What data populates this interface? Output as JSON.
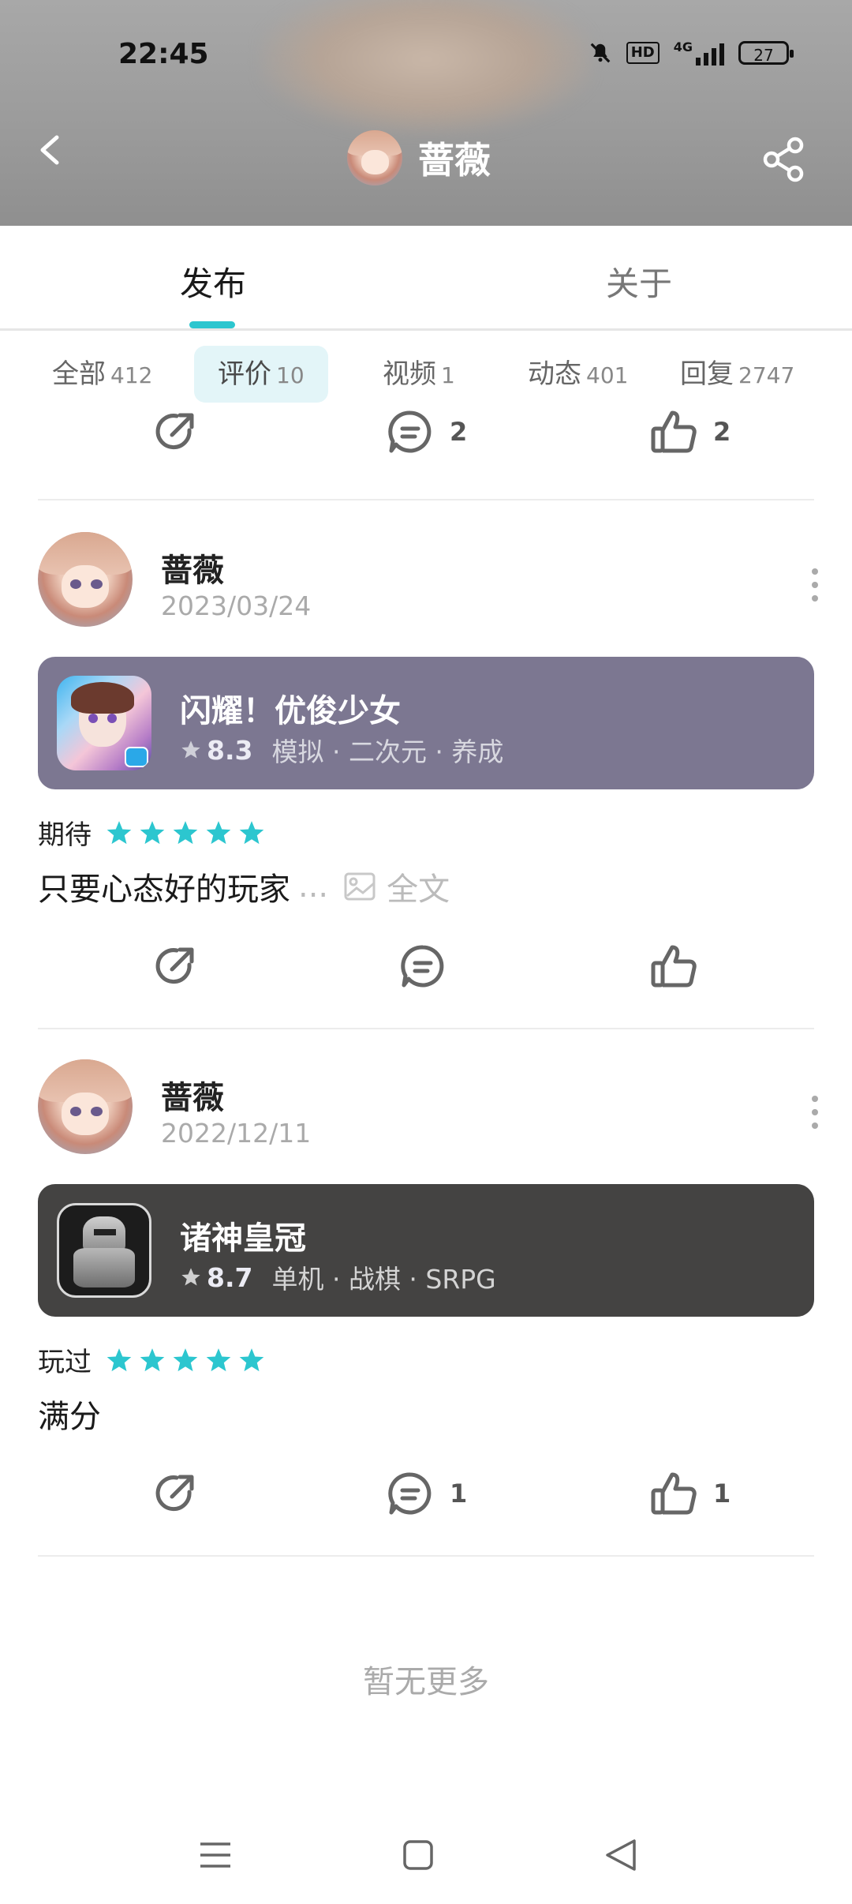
{
  "status_bar": {
    "time": "22:45",
    "hd": "HD",
    "network": "4G",
    "battery": "27"
  },
  "header": {
    "title": "蔷薇"
  },
  "tabs": [
    {
      "label": "发布"
    },
    {
      "label": "关于"
    }
  ],
  "filters": [
    {
      "label": "全部",
      "count": "412"
    },
    {
      "label": "评价",
      "count": "10"
    },
    {
      "label": "视频",
      "count": "1"
    },
    {
      "label": "动态",
      "count": "401"
    },
    {
      "label": "回复",
      "count": "2747"
    }
  ],
  "top_actions": {
    "comments": "2",
    "likes": "2"
  },
  "posts": [
    {
      "author": "蔷薇",
      "date": "2023/03/24",
      "game": {
        "title": "闪耀！优俊少女",
        "score": "8.3",
        "tags": "模拟 · 二次元 · 养成",
        "card_color": "#7c7791"
      },
      "rating_label": "期待",
      "stars": 5,
      "text": "只要心态好的玩家",
      "ellipsis": "...",
      "full_label": "全文",
      "comments": "",
      "likes": ""
    },
    {
      "author": "蔷薇",
      "date": "2022/12/11",
      "game": {
        "title": "诸神皇冠",
        "score": "8.7",
        "tags": "单机 · 战棋 · SRPG",
        "card_color": "#444342"
      },
      "rating_label": "玩过",
      "stars": 5,
      "text": "满分",
      "comments": "1",
      "likes": "1"
    }
  ],
  "footer": {
    "no_more": "暂无更多"
  },
  "colors": {
    "accent": "#2cc6cf",
    "star": "#2cc6cf"
  }
}
